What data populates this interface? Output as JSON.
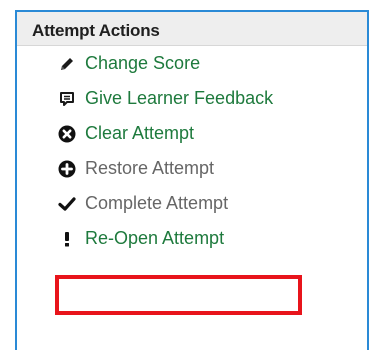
{
  "panel": {
    "title": "Attempt Actions"
  },
  "actions": [
    {
      "label": "Change Score",
      "icon": "pencil-icon",
      "enabled": true
    },
    {
      "label": "Give Learner Feedback",
      "icon": "speech-bubble-icon",
      "enabled": true
    },
    {
      "label": "Clear Attempt",
      "icon": "clear-x-icon",
      "enabled": true
    },
    {
      "label": "Restore Attempt",
      "icon": "plus-circle-icon",
      "enabled": false
    },
    {
      "label": "Complete Attempt",
      "icon": "checkmark-icon",
      "enabled": false
    },
    {
      "label": "Re-Open Attempt",
      "icon": "exclamation-icon",
      "enabled": true,
      "highlighted": true
    }
  ],
  "colors": {
    "panel_border": "#2a8ad6",
    "header_bg": "#eeeeee",
    "enabled_text": "#1e7a3d",
    "disabled_text": "#666666",
    "highlight": "#e8141b"
  }
}
